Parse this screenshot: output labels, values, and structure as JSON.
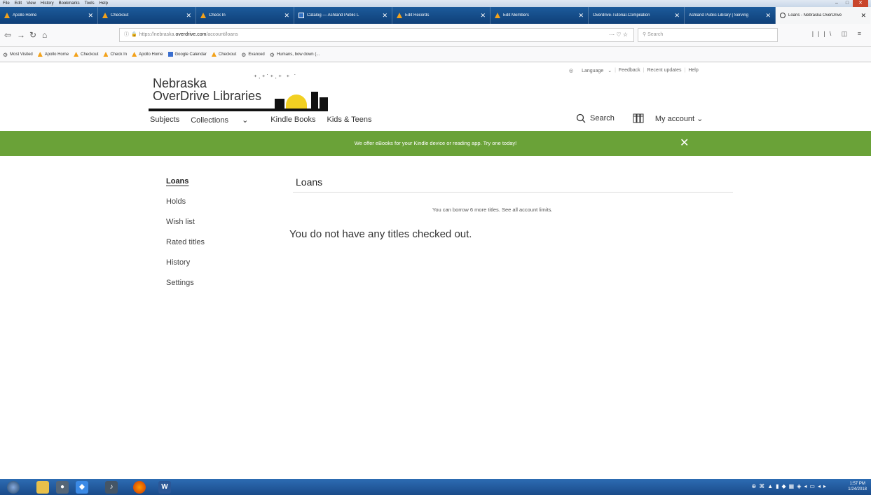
{
  "browser": {
    "menu": [
      "File",
      "Edit",
      "View",
      "History",
      "Bookmarks",
      "Tools",
      "Help"
    ],
    "tabs": [
      {
        "label": "Apollo Home",
        "icon": "orange",
        "active": false,
        "w": 140
      },
      {
        "label": "Checkout",
        "icon": "orange",
        "active": false,
        "w": 140
      },
      {
        "label": "Check In",
        "icon": "orange",
        "active": false,
        "w": 140
      },
      {
        "label": "Catalog — Ashland Public L",
        "icon": "blue",
        "active": false,
        "w": 140
      },
      {
        "label": "Edit Records",
        "icon": "orange",
        "active": false,
        "w": 140
      },
      {
        "label": "Edit Members",
        "icon": "orange",
        "active": false,
        "w": 140
      },
      {
        "label": "Overdrive-Tutorial-Compilation",
        "icon": "none",
        "active": false,
        "w": 137
      },
      {
        "label": "Ashland Public Library | Serving",
        "icon": "none",
        "active": false,
        "w": 130
      },
      {
        "label": "Loans - Nebraska OverDrive",
        "icon": "circle",
        "active": true,
        "w": 136
      }
    ],
    "url_prefix": "https://nebraska.",
    "url_host": "overdrive.com",
    "url_path": "/account/loans",
    "search_placeholder": "Search",
    "bookmarks": [
      {
        "label": "Most Visited",
        "icon": "gear"
      },
      {
        "label": "Apollo Home",
        "icon": "orange"
      },
      {
        "label": "Checkout",
        "icon": "orange"
      },
      {
        "label": "Check In",
        "icon": "orange"
      },
      {
        "label": "Apollo Home",
        "icon": "orange"
      },
      {
        "label": "Google Calendar",
        "icon": "cal"
      },
      {
        "label": "Checkout",
        "icon": "orange"
      },
      {
        "label": "Evanced",
        "icon": "gear"
      },
      {
        "label": "Humans, bow down (...",
        "icon": "gear"
      }
    ]
  },
  "header": {
    "logo_line1": "Nebraska",
    "logo_line2": "OverDrive Libraries",
    "top_links": [
      "Language",
      "Feedback",
      "Recent updates",
      "Help"
    ],
    "subnav": [
      "Subjects",
      "Collections",
      "Kindle Books",
      "Kids & Teens"
    ],
    "search_label": "Search",
    "account_label": "My account"
  },
  "banner": {
    "text": "We offer eBooks for your Kindle device or reading app. Try one today!",
    "close_label": "✕",
    "color": "#6aa238"
  },
  "sidemenu": [
    "Loans",
    "Holds",
    "Wish list",
    "Rated titles",
    "History",
    "Settings"
  ],
  "main": {
    "title": "Loans",
    "limits_text": "You can borrow 6 more titles.",
    "limits_link": "See all account limits.",
    "empty_text": "You do not have any titles checked out."
  },
  "taskbar": {
    "time": "1:57 PM",
    "date": "1/24/2018"
  }
}
